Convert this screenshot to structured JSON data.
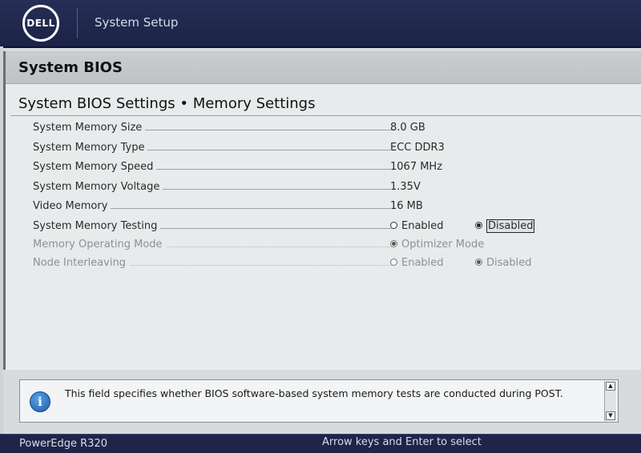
{
  "header": {
    "logo_text": "DELL",
    "app_title": "System Setup"
  },
  "panel": {
    "title": "System BIOS",
    "page_title": "System BIOS Settings • Memory Settings"
  },
  "settings": [
    {
      "label": "System Memory Size",
      "value": "8.0 GB"
    },
    {
      "label": "System Memory Type",
      "value": "ECC DDR3"
    },
    {
      "label": "System Memory Speed",
      "value": "1067 MHz"
    },
    {
      "label": "System Memory Voltage",
      "value": "1.35V"
    },
    {
      "label": "Video Memory",
      "value": "16 MB"
    },
    {
      "label": "System Memory Testing",
      "options": [
        "Enabled",
        "Disabled"
      ],
      "selected": "Disabled"
    },
    {
      "label": "Memory Operating Mode",
      "options": [
        "Optimizer Mode"
      ],
      "selected": "Optimizer Mode",
      "disabled": true
    },
    {
      "label": "Node Interleaving",
      "options": [
        "Enabled",
        "Disabled"
      ],
      "selected": "Disabled",
      "disabled": true
    }
  ],
  "help": {
    "icon": "info-icon",
    "text": "This field specifies whether BIOS software-based system memory tests are conducted during POST."
  },
  "footer": {
    "model": "PowerEdge R320",
    "hint": "Arrow keys and Enter to select"
  },
  "colors": {
    "header_bg": "#1f2448",
    "panel_bg": "#e8ebec",
    "panel_header_bg": "#c9cdd0",
    "disabled_text": "#8d9194"
  }
}
